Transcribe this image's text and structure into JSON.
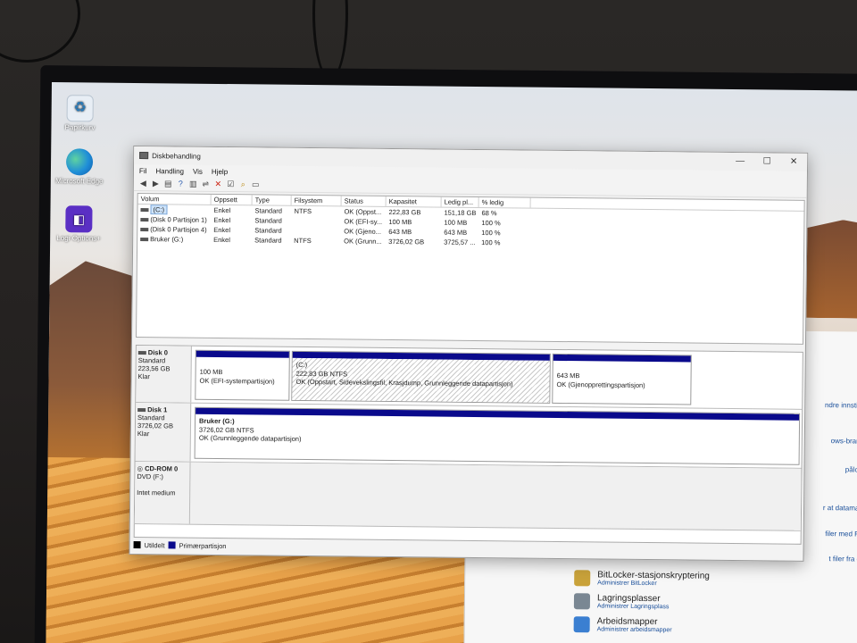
{
  "desktop": {
    "icons": [
      {
        "label": "Papirkurv"
      },
      {
        "label": "Microsoft Edge"
      },
      {
        "label": "Logi Options+"
      }
    ]
  },
  "window": {
    "title": "Diskbehandling",
    "controls": {
      "minimize": "—",
      "maximize": "☐",
      "close": "✕"
    },
    "menu": [
      "Fil",
      "Handling",
      "Vis",
      "Hjelp"
    ]
  },
  "volume_list": {
    "headers": [
      "Volum",
      "Oppsett",
      "Type",
      "Filsystem",
      "Status",
      "Kapasitet",
      "Ledig pl...",
      "% ledig"
    ],
    "rows": [
      [
        "(C:)",
        "Enkel",
        "Standard",
        "NTFS",
        "OK (Oppst...",
        "222,83 GB",
        "151,18 GB",
        "68 %"
      ],
      [
        "(Disk 0 Partisjon 1)",
        "Enkel",
        "Standard",
        "",
        "OK (EFI-sy...",
        "100 MB",
        "100 MB",
        "100 %"
      ],
      [
        "(Disk 0 Partisjon 4)",
        "Enkel",
        "Standard",
        "",
        "OK (Gjeno...",
        "643 MB",
        "643 MB",
        "100 %"
      ],
      [
        "Bruker (G:)",
        "Enkel",
        "Standard",
        "NTFS",
        "OK (Grunn...",
        "3726,02 GB",
        "3725,57 ...",
        "100 %"
      ]
    ]
  },
  "disks": {
    "disk0": {
      "name": "Disk 0",
      "kind": "Standard",
      "size": "223,56 GB",
      "state": "Klar",
      "p1": {
        "size": "100 MB",
        "status": "OK (EFI-systempartisjon)"
      },
      "p2": {
        "title": "(C:)",
        "size": "222,83 GB NTFS",
        "status": "OK (Oppstart, Sidevekslingsfil, Krasjdump, Grunnleggende datapartisjon)"
      },
      "p3": {
        "size": "643 MB",
        "status": "OK (Gjenopprettingspartisjon)"
      }
    },
    "disk1": {
      "name": "Disk 1",
      "kind": "Standard",
      "size": "3726,02 GB",
      "state": "Klar",
      "p1": {
        "title": "Bruker  (G:)",
        "size": "3726,02 GB NTFS",
        "status": "OK (Grunnleggende datapartisjon)"
      }
    },
    "cdrom": {
      "name": "CD-ROM 0",
      "kind": "DVD (F:)",
      "state": "Intet medium"
    }
  },
  "legend": {
    "unallocated": "Utildelt",
    "primary": "Primærpartisjon"
  },
  "control_panel": {
    "side_links": [
      "ndre innstillinger",
      "ows-brannmur",
      "pålogging",
      "r at datamaskine",
      "filer med Fillogg",
      "t filer fra en sik"
    ],
    "items": [
      {
        "title": "BitLocker-stasjonskryptering",
        "sub": "Administrer BitLocker"
      },
      {
        "title": "Lagringsplasser",
        "sub": "Administrer Lagringsplass"
      },
      {
        "title": "Arbeidsmapper",
        "sub": "Administrer arbeidsmapper"
      }
    ]
  },
  "colors": {
    "primary_partition": "#0a0a8c",
    "unallocated": "#000000"
  }
}
